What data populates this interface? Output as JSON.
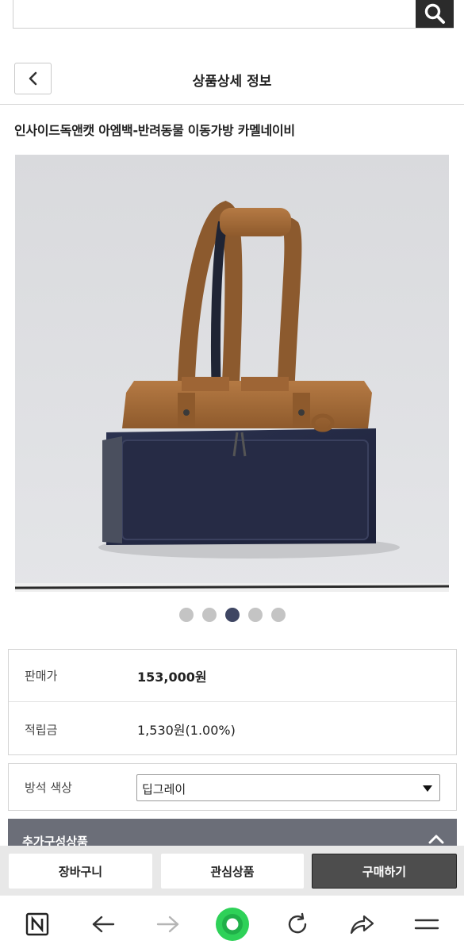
{
  "search": {
    "value": "",
    "placeholder": ""
  },
  "header": {
    "title": "상품상세 정보"
  },
  "product": {
    "name": "인사이드독앤캣 아엠백-반려동물 이동가방 카멜네이비",
    "image_alt": "bag photo",
    "carousel": {
      "count": 5,
      "active_index": 2
    }
  },
  "price_table": {
    "price_label": "판매가",
    "price_value": "153,000원",
    "points_label": "적립금",
    "points_value": "1,530원(1.00%)"
  },
  "option": {
    "label": "방석 색상",
    "selected": "딥그레이"
  },
  "addon": {
    "label": "추가구성상품"
  },
  "actions": {
    "cart": "장바구니",
    "wishlist": "관심상품",
    "buy": "구매하기"
  },
  "browser_nav": {
    "icons": [
      "naver-icon",
      "back-arrow-icon",
      "forward-arrow-icon",
      "home-circle-icon",
      "refresh-icon",
      "share-icon",
      "menu-icon"
    ],
    "home_color": "#2ed158"
  },
  "colors": {
    "dark_button": "#4d4d4d",
    "addon_bar": "#6b6e78",
    "dot_active": "#3f4663"
  }
}
